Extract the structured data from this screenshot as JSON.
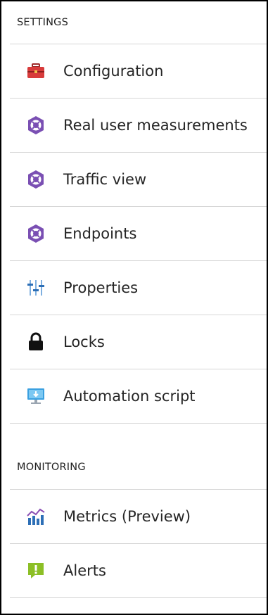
{
  "settings": {
    "header": "SETTINGS",
    "items": [
      {
        "label": "Configuration",
        "icon": "toolbox-icon"
      },
      {
        "label": "Real user measurements",
        "icon": "traffic-manager-icon"
      },
      {
        "label": "Traffic view",
        "icon": "traffic-manager-icon"
      },
      {
        "label": "Endpoints",
        "icon": "traffic-manager-icon"
      },
      {
        "label": "Properties",
        "icon": "properties-sliders-icon"
      },
      {
        "label": "Locks",
        "icon": "lock-icon"
      },
      {
        "label": "Automation script",
        "icon": "automation-monitor-icon"
      }
    ]
  },
  "monitoring": {
    "header": "MONITORING",
    "items": [
      {
        "label": "Metrics (Preview)",
        "icon": "metrics-chart-icon"
      },
      {
        "label": "Alerts",
        "icon": "alert-icon"
      }
    ]
  },
  "colors": {
    "toolbox_red": "#d83b3b",
    "traffic_purple": "#7a4fb3",
    "properties_blue": "#4a8ccf",
    "lock_black": "#111111",
    "monitor_blue": "#3aa0e0",
    "metrics_blue": "#2d6fb6",
    "alert_green": "#8cbf26",
    "divider": "#d6d6d6"
  }
}
